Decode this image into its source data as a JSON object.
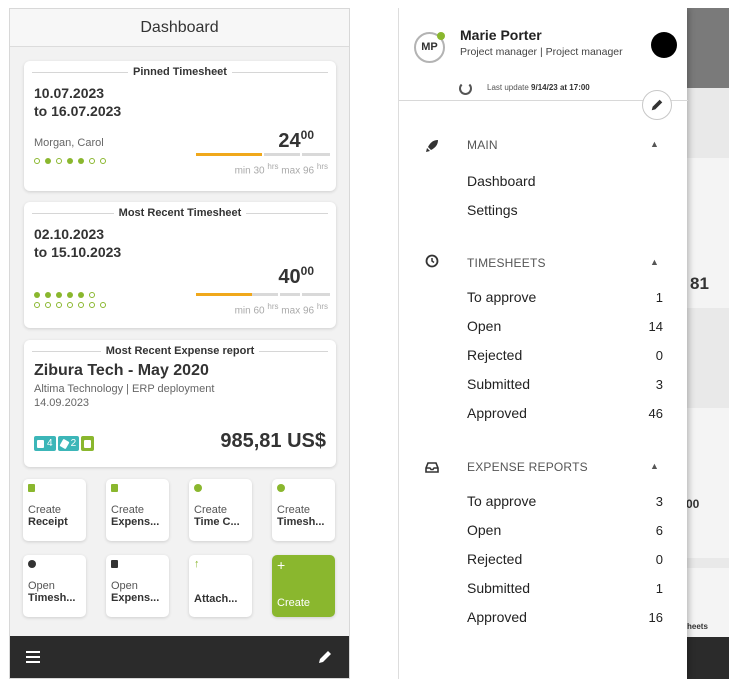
{
  "dashboard": {
    "title": "Dashboard",
    "pinned": {
      "section_title": "Pinned Timesheet",
      "date_line1": "10.07.2023",
      "date_line2": "to 16.07.2023",
      "person": "Morgan, Carol",
      "hours_int": "24",
      "hours_dec": "00",
      "min_label": "min 30",
      "max_label": "max 96",
      "unit": "hrs",
      "progress": 0.5
    },
    "recent": {
      "section_title": "Most Recent Timesheet",
      "date_line1": "02.10.2023",
      "date_line2": "to 15.10.2023",
      "hours_int": "40",
      "hours_dec": "00",
      "min_label": "min 60",
      "max_label": "max 96",
      "unit": "hrs",
      "progress": 0.42
    },
    "expense": {
      "section_title": "Most Recent Expense report",
      "title": "Zibura Tech - May 2020",
      "subtitle": "Altima Technology | ERP deployment",
      "date": "14.09.2023",
      "receipts": "4",
      "attachments": "2",
      "amount": "985,81 US$"
    },
    "tiles": [
      {
        "line1": "Create",
        "line2": "Receipt"
      },
      {
        "line1": "Create",
        "line2": "Expens..."
      },
      {
        "line1": "Create",
        "line2": "Time C..."
      },
      {
        "line1": "Create",
        "line2": "Timesh..."
      },
      {
        "line1": "Open",
        "line2": "Timesh..."
      },
      {
        "line1": "Open",
        "line2": "Expens..."
      },
      {
        "line1": "",
        "line2": "Attach..."
      },
      {
        "line1": "",
        "line2": "Create"
      }
    ]
  },
  "drawer": {
    "initials": "MP",
    "user_name": "Marie Porter",
    "user_role": "Project manager | Project manager",
    "last_update_label": "Last update",
    "last_update_value": "9/14/23 at 17:00",
    "main": {
      "label": "MAIN",
      "items": [
        "Dashboard",
        "Settings"
      ]
    },
    "timesheets": {
      "label": "TIMESHEETS",
      "items": [
        {
          "label": "To approve",
          "count": "1"
        },
        {
          "label": "Open",
          "count": "14"
        },
        {
          "label": "Rejected",
          "count": "0"
        },
        {
          "label": "Submitted",
          "count": "3"
        },
        {
          "label": "Approved",
          "count": "46"
        }
      ]
    },
    "expense_reports": {
      "label": "EXPENSE REPORTS",
      "items": [
        {
          "label": "To approve",
          "count": "3"
        },
        {
          "label": "Open",
          "count": "6"
        },
        {
          "label": "Rejected",
          "count": "0"
        },
        {
          "label": "Submitted",
          "count": "1"
        },
        {
          "label": "Approved",
          "count": "16"
        }
      ]
    }
  },
  "background_peek": {
    "value1": "81",
    "value2": "00",
    "label": "heets"
  },
  "colors": {
    "accent_green": "#8ab72e",
    "progress_orange": "#f0a81b",
    "teal": "#3cb6b8",
    "dark_bar": "#2b2b2b"
  }
}
